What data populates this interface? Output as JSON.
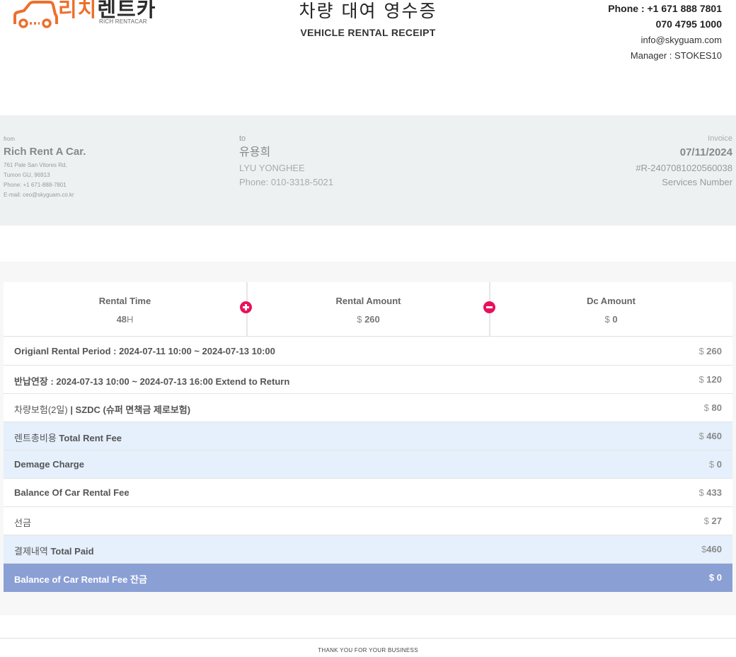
{
  "logo": {
    "korean_part1": "리치",
    "korean_part2": "렌트카",
    "sub": "RICH RENTACAR"
  },
  "title": {
    "korean": "차량 대여 영수증",
    "english": "VEHICLE RENTAL RECEIPT"
  },
  "contact": {
    "phone1": "Phone : +1 671 888 7801",
    "phone2": "070 4795 1000",
    "email": "info@skyguam.com",
    "manager": "Manager : STOKES10"
  },
  "from": {
    "label": "from",
    "name": "Rich Rent A Car.",
    "address1": "761 Pale San Vitores Rd,",
    "address2": "Tumon GU, 96913",
    "phone": "Phone: +1 671-888-7801",
    "email": "E-mail: ceo@skyguam.co.kr"
  },
  "to": {
    "label": "to",
    "name_kr": "유용희",
    "name_en": "LYU YONGHEE",
    "phone": "Phone: 010-3318-5021"
  },
  "invoice": {
    "label": "Invoice",
    "date": "07/11/2024",
    "number": "#R-2407081020560038",
    "services": "Services Number"
  },
  "stats": {
    "rental_time_label": "Rental Time",
    "rental_time_value": "48",
    "rental_time_unit": "H",
    "rental_amount_label": "Rental Amount",
    "rental_amount_currency": "$",
    "rental_amount_value": "260",
    "dc_amount_label": "Dc Amount",
    "dc_amount_currency": "$",
    "dc_amount_value": "0"
  },
  "rows": [
    {
      "label": "Origianl Rental Period : 2024-07-11 10:00 ~ 2024-07-13 10:00",
      "currency": "$",
      "amount": "260"
    },
    {
      "label": "반납연장 : 2024-07-13 10:00 ~ 2024-07-13 16:00 Extend to Return",
      "currency": "$",
      "amount": "120"
    },
    {
      "label_normal": "차량보험(2일) ",
      "label": "| SZDC (슈퍼 면책금 제로보험)",
      "currency": "$",
      "amount": "80"
    },
    {
      "label_normal": "렌트총비용 ",
      "label": "Total Rent Fee",
      "currency": "$",
      "amount": "460"
    },
    {
      "label": "Demage Charge",
      "currency": "$",
      "amount": "0"
    },
    {
      "label": "Balance Of Car Rental Fee",
      "currency": "$",
      "amount": "433"
    },
    {
      "label_normal": "선금",
      "label": "",
      "currency": "$",
      "amount": "27"
    },
    {
      "label_normal": "결제내역 ",
      "label": "Total Paid",
      "currency": "$",
      "amount": "460"
    },
    {
      "label": "Balance of Car Rental Fee 잔금",
      "currency": "$",
      "amount": "0"
    }
  ],
  "footer": "THANK YOU FOR YOUR BUSINESS",
  "colors": {
    "logo_orange": "#ee6f2d",
    "info_band": "#eef1f2",
    "blue_row": "#e5f0fc",
    "dark_row": "#8a9fd4",
    "op_icon": "#e8115c"
  }
}
